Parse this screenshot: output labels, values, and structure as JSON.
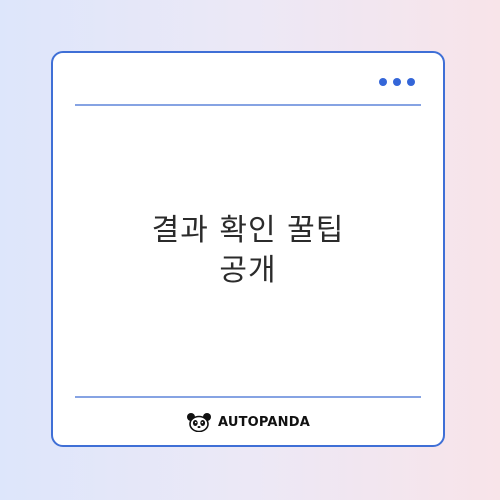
{
  "card": {
    "menu_icon": "more-horizontal-dots-icon",
    "title_lines": [
      "결과 확인 꿀팁",
      "공개"
    ]
  },
  "brand": {
    "logo_icon": "panda-logo-icon",
    "name": "AUTOPANDA"
  },
  "colors": {
    "accent": "#3466d8",
    "border": "#3f6fd6",
    "rule": "#86a3e3",
    "text": "#2b2b2b"
  }
}
